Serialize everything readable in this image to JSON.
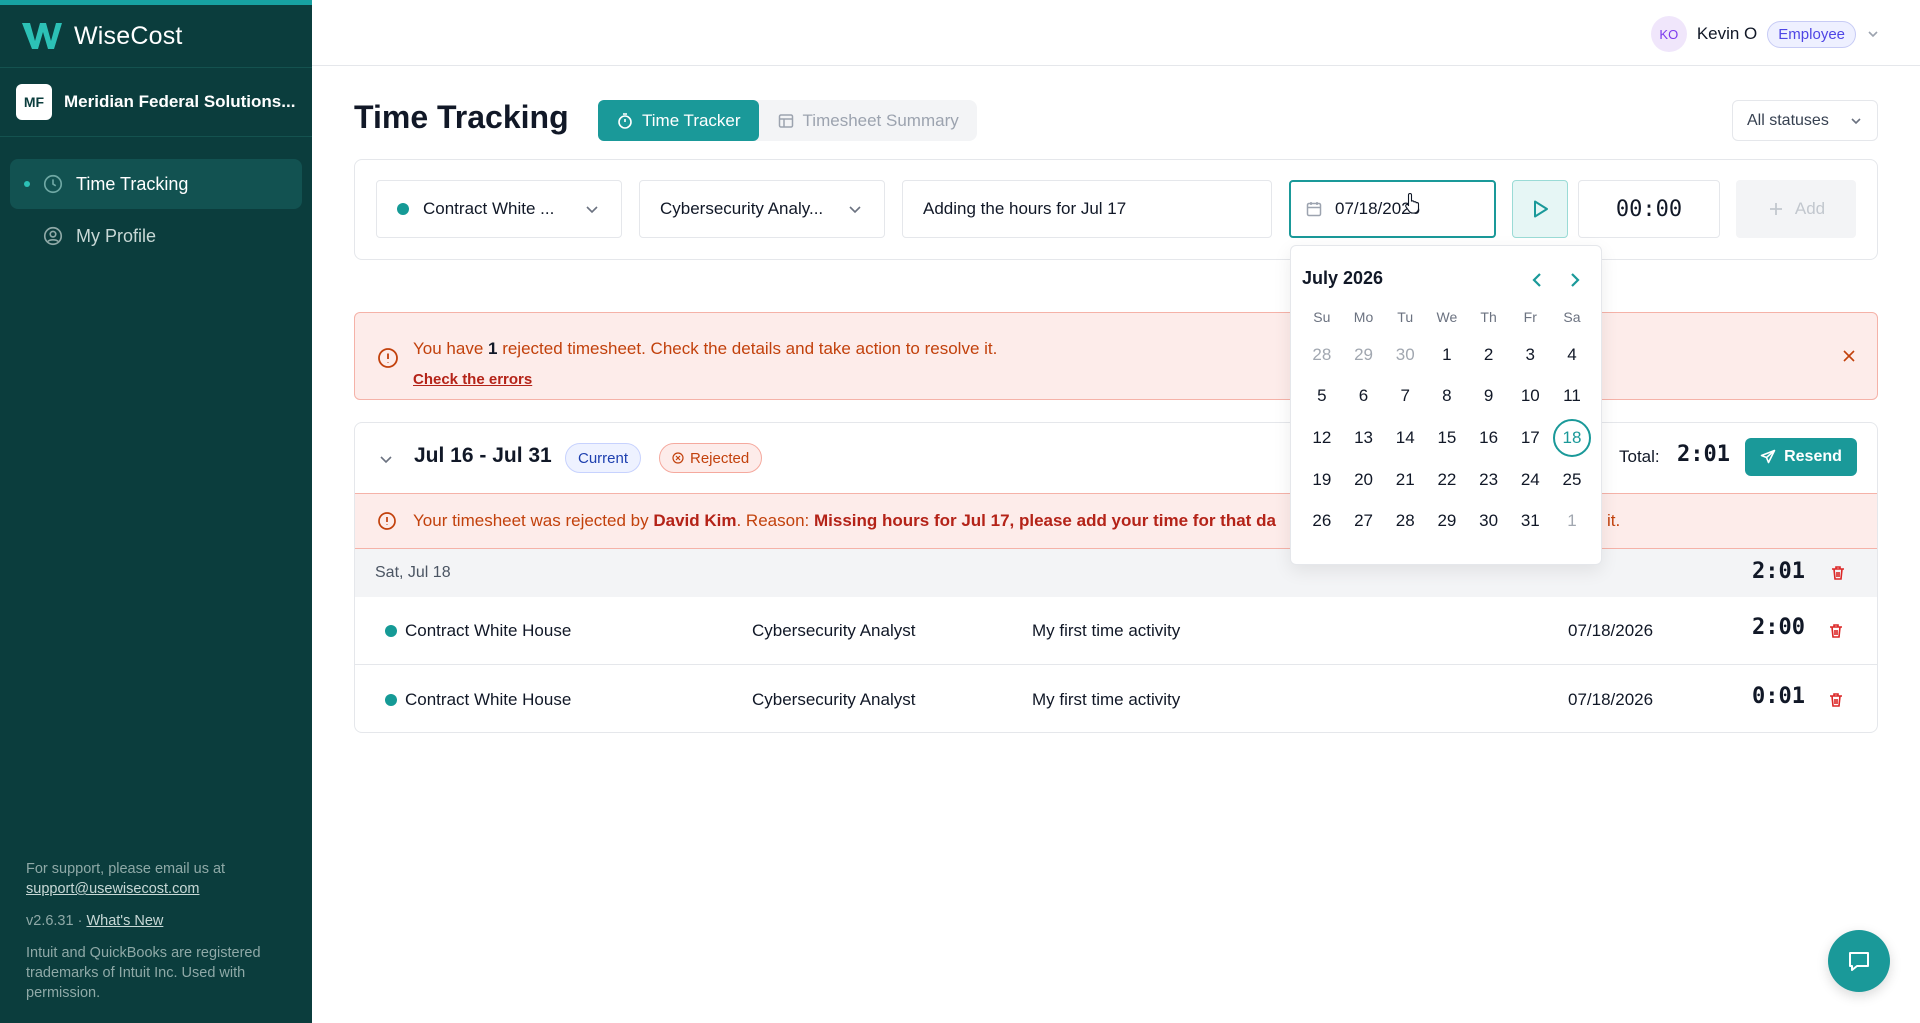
{
  "app": {
    "name": "WiseCost",
    "version": "v2.6.31",
    "accent": "#1a9999",
    "sidebar_bg": "#0b3d3d"
  },
  "org": {
    "initials": "MF",
    "name": "Meridian Federal Solutions..."
  },
  "nav": {
    "time_tracking": "Time Tracking",
    "my_profile": "My Profile"
  },
  "sidebar_footer": {
    "support_text": "For support, please email us at",
    "support_email": "support@usewisecost.com",
    "version": "v2.6.31 · ",
    "whats_new": "What's New",
    "trademark": "Intuit and QuickBooks are registered trademarks of Intuit Inc. Used with permission."
  },
  "user": {
    "initials": "KO",
    "name": "Kevin O",
    "role": "Employee"
  },
  "page": {
    "title": "Time Tracking",
    "tab_tracker": "Time Tracker",
    "tab_summary": "Timesheet Summary",
    "status_filter": "All statuses"
  },
  "tracker": {
    "contract": "Contract White ...",
    "role": "Cybersecurity Analy...",
    "description": "Adding the hours for Jul 17",
    "date": "07/18/2026",
    "timer": "00:00",
    "add_label": "Add"
  },
  "alert": {
    "pre": "You have ",
    "count": "1",
    "post": " rejected timesheet. Check the details and take action to resolve it.",
    "link": "Check the errors"
  },
  "timesheet": {
    "period": "Jul 16 - Jul 31",
    "current_badge": "Current",
    "rejected_badge": "Rejected",
    "total_label": "Total:",
    "total": "2:01",
    "resend_label": "Resend",
    "reject_pre": "Your timesheet was rejected by ",
    "reject_by": "David Kim",
    "reject_mid": ". Reason: ",
    "reject_reason": "Missing hours for Jul 17, please add your time for that da",
    "reject_tail": "it.",
    "day_label": "Sat, Jul 18",
    "day_total": "2:01",
    "entries": [
      {
        "contract": "Contract White House",
        "role": "Cybersecurity Analyst",
        "description": "My first time activity",
        "date": "07/18/2026",
        "duration": "2:00"
      },
      {
        "contract": "Contract White House",
        "role": "Cybersecurity Analyst",
        "description": "My first time activity",
        "date": "07/18/2026",
        "duration": "0:01"
      }
    ]
  },
  "calendar": {
    "month": "July 2026",
    "weekdays": [
      "Su",
      "Mo",
      "Tu",
      "We",
      "Th",
      "Fr",
      "Sa"
    ],
    "selected": "18",
    "weeks": [
      [
        "28",
        "29",
        "30",
        "1",
        "2",
        "3",
        "4"
      ],
      [
        "5",
        "6",
        "7",
        "8",
        "9",
        "10",
        "11"
      ],
      [
        "12",
        "13",
        "14",
        "15",
        "16",
        "17",
        "18"
      ],
      [
        "19",
        "20",
        "21",
        "22",
        "23",
        "24",
        "25"
      ],
      [
        "26",
        "27",
        "28",
        "29",
        "30",
        "31",
        "1"
      ]
    ]
  }
}
